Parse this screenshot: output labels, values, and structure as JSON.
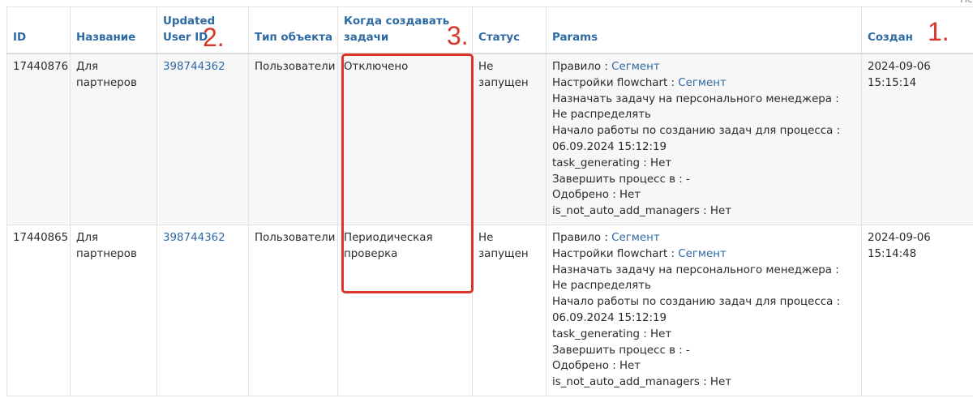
{
  "top_corner_text": "Пс",
  "headers": {
    "id": "ID",
    "name": "Название",
    "updated_user_id": "Updated User ID",
    "object_type": "Тип объекта",
    "when_create": "Когда создавать задачи",
    "status": "Статус",
    "params": "Params",
    "created": "Создан"
  },
  "annotations": {
    "n1": "1.",
    "n2": "2.",
    "n3": "3."
  },
  "rows": [
    {
      "id": "17440876",
      "name": "Для партнеров",
      "updated_user_id": "398744362",
      "object_type": "Пользователи",
      "when_create": "Отключено",
      "status": "Не запущен",
      "params": {
        "rule_label": "Правило : ",
        "rule_value": "Сегмент",
        "flowchart_label": "Настройки flowchart : ",
        "flowchart_value": "Сегмент",
        "assign": "Назначать задачу на персонального менеджера : Не распределять",
        "start": "Начало работы по созданию задач для процесса : 06.09.2024 15:12:19",
        "task_generating": "task_generating : Нет",
        "finish": "Завершить процесс в : -",
        "approved": "Одобрено : Нет",
        "auto_add": "is_not_auto_add_managers : Нет"
      },
      "created": "2024-09-06 15:15:14"
    },
    {
      "id": "17440865",
      "name": "Для партнеров",
      "updated_user_id": "398744362",
      "object_type": "Пользователи",
      "when_create": "Периодическая проверка",
      "status": "Не запущен",
      "params": {
        "rule_label": "Правило : ",
        "rule_value": "Сегмент",
        "flowchart_label": "Настройки flowchart : ",
        "flowchart_value": "Сегмент",
        "assign": "Назначать задачу на персонального менеджера : Не распределять",
        "start": "Начало работы по созданию задач для процесса : 06.09.2024 15:12:19",
        "task_generating": "task_generating : Нет",
        "finish": "Завершить процесс в : -",
        "approved": "Одобрено : Нет",
        "auto_add": "is_not_auto_add_managers : Нет"
      },
      "created": "2024-09-06 15:14:48"
    }
  ]
}
